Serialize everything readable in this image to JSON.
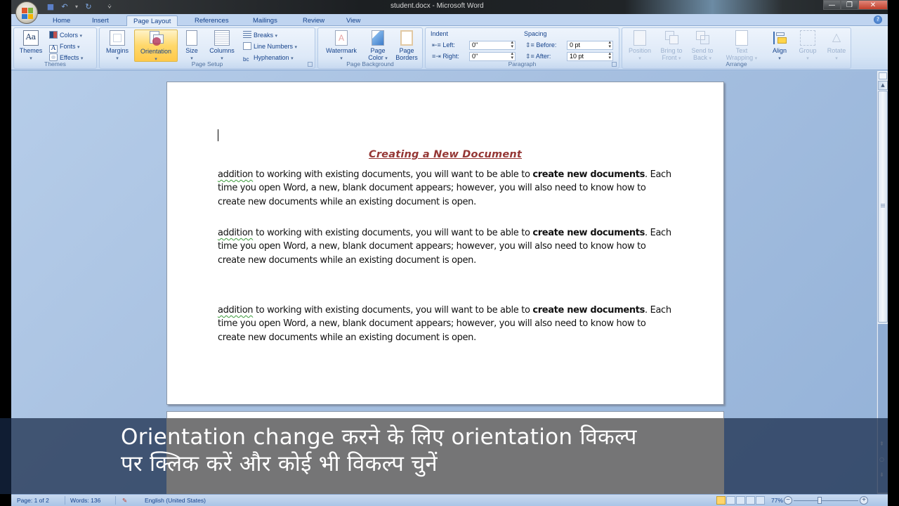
{
  "window": {
    "title": "student.docx - Microsoft Word",
    "minimize_icon": "minimize-icon",
    "maximize_icon": "restore-icon",
    "close_icon": "close-icon",
    "minimize_glyph": "—",
    "restore_glyph": "❐",
    "close_glyph": "✕"
  },
  "quick_access": {
    "save_glyph": "■",
    "undo_glyph": "↶",
    "undo_dropdown_glyph": "▾",
    "redo_glyph": "↻",
    "customize_glyph": "⩒"
  },
  "tabs": [
    {
      "label": "Home",
      "active": false
    },
    {
      "label": "Insert",
      "active": false
    },
    {
      "label": "Page Layout",
      "active": true
    },
    {
      "label": "References",
      "active": false
    },
    {
      "label": "Mailings",
      "active": false
    },
    {
      "label": "Review",
      "active": false
    },
    {
      "label": "View",
      "active": false
    }
  ],
  "help_glyph": "?",
  "ribbon": {
    "themes_group": {
      "label": "Themes",
      "themes_button": "Themes",
      "colors_button": "Colors",
      "fonts_button": "Fonts",
      "effects_button": "Effects"
    },
    "page_setup_group": {
      "label": "Page Setup",
      "margins_button": "Margins",
      "orientation_button": "Orientation",
      "size_button": "Size",
      "columns_button": "Columns",
      "breaks_button": "Breaks",
      "line_numbers_button": "Line Numbers",
      "hyphenation_button": "Hyphenation"
    },
    "page_background_group": {
      "label": "Page Background",
      "watermark_button": "Watermark",
      "page_color_line1": "Page",
      "page_color_line2": "Color",
      "page_borders_line1": "Page",
      "page_borders_line2": "Borders"
    },
    "paragraph_group": {
      "label": "Paragraph",
      "indent_heading": "Indent",
      "indent_left_label": "Left:",
      "indent_left_value": "0\"",
      "indent_right_label": "Right:",
      "indent_right_value": "0\"",
      "spacing_heading": "Spacing",
      "spacing_before_label": "Before:",
      "spacing_before_value": "0 pt",
      "spacing_after_label": "After:",
      "spacing_after_value": "10 pt"
    },
    "arrange_group": {
      "label": "Arrange",
      "position_button": "Position",
      "bring_to_front_line1": "Bring to",
      "bring_to_front_line2": "Front",
      "send_to_back_line1": "Send to",
      "send_to_back_line2": "Back",
      "text_wrapping_line1": "Text",
      "text_wrapping_line2": "Wrapping",
      "align_button": "Align",
      "group_button": "Group",
      "rotate_button": "Rotate"
    }
  },
  "document": {
    "title": "Creating a New Document",
    "paragraphs": [
      {
        "squiggle_word": "addition",
        "text_before_bold": " to working with existing documents, you will want to be able to ",
        "bold": "create new documents",
        "text_after_bold": ". Each time you open Word, a new, blank document appears; however, you will also need to know how to create new documents while an existing document is open."
      },
      {
        "squiggle_word": "addition",
        "text_before_bold": " to working with existing documents, you will want to be able to ",
        "bold": "create new documents",
        "text_after_bold": ". Each time you open Word, a new, blank document appears; however, you will also need to know how to create new documents while an existing document is open."
      },
      {
        "squiggle_word": "addition",
        "text_before_bold": " to working with existing documents, you will want to be able to ",
        "bold": "create new documents",
        "text_after_bold": ". Each time you open Word, a new, blank document appears; however, you will also need to know how to create new documents while an existing document is open."
      }
    ]
  },
  "scrollbar": {
    "up_glyph": "▲",
    "prev_page_glyph": "⇞",
    "select_browse_glyph": "○",
    "next_page_glyph": "⇟"
  },
  "statusbar": {
    "page": "Page: 1 of 2",
    "words": "Words: 136",
    "proofing_icon": "proofing-icon",
    "language": "English (United States)",
    "zoom_level": "77%",
    "zoom_out_glyph": "−",
    "zoom_in_glyph": "+"
  },
  "subtitle": {
    "line1": "Orientation change करने के लिए orientation विकल्प",
    "line2": "पर क्लिक करें और कोई भी विकल्प चुनें"
  },
  "colors": {
    "title_red": "#953735",
    "ribbon_text": "#15428b",
    "hover_yellow": "#ffd86b"
  }
}
